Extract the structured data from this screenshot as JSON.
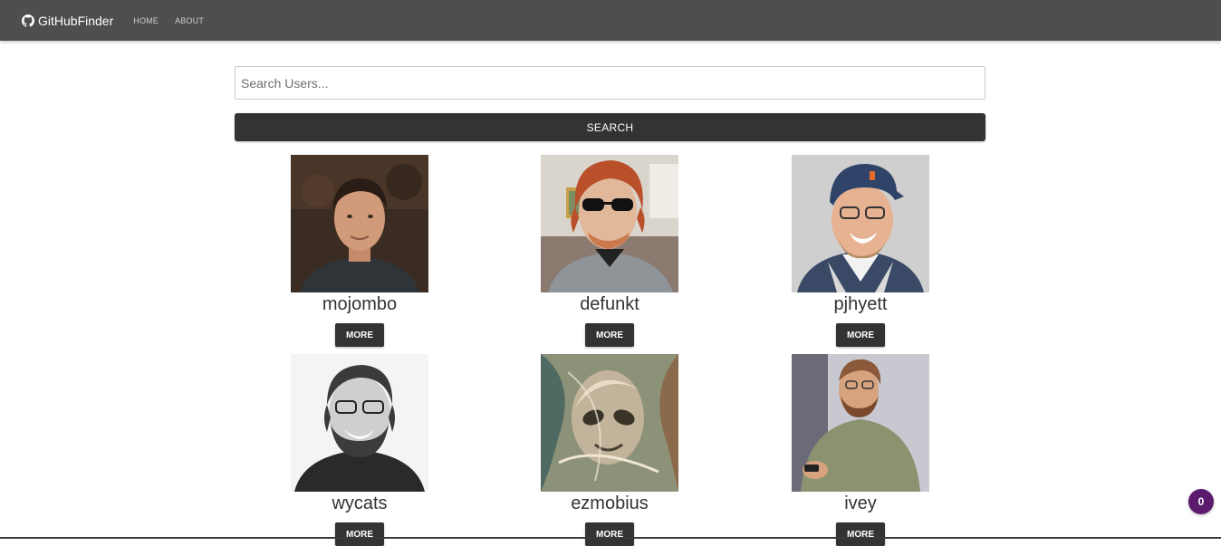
{
  "navbar": {
    "brand_icon": "github-icon",
    "brand_label": "GitHubFinder",
    "links": [
      {
        "label": "HOME"
      },
      {
        "label": "ABOUT"
      }
    ]
  },
  "search": {
    "placeholder": "Search Users...",
    "value": "",
    "button_label": "SEARCH"
  },
  "users": [
    {
      "login": "mojombo",
      "more_label": "MORE"
    },
    {
      "login": "defunkt",
      "more_label": "MORE"
    },
    {
      "login": "pjhyett",
      "more_label": "MORE"
    },
    {
      "login": "wycats",
      "more_label": "MORE"
    },
    {
      "login": "ezmobius",
      "more_label": "MORE"
    },
    {
      "login": "ivey",
      "more_label": "MORE"
    }
  ],
  "badge": {
    "count": "0"
  },
  "colors": {
    "navbar": "#4f4e4c",
    "button": "#333333",
    "badge": "#5c1a6e"
  }
}
